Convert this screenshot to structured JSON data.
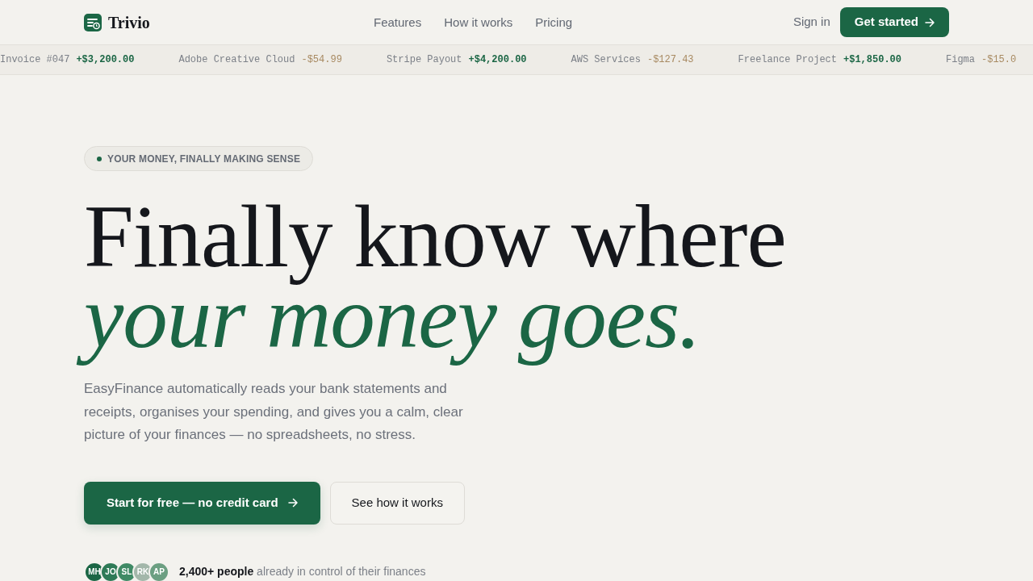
{
  "navbar": {
    "brand": "Trivio",
    "links": [
      "Features",
      "How it works",
      "Pricing"
    ],
    "sign_in": "Sign in",
    "cta": "Get started"
  },
  "ticker": [
    {
      "label": "Invoice #047",
      "amount": "+$3,200.00",
      "kind": "credit"
    },
    {
      "label": "Adobe Creative Cloud",
      "amount": "-$54.99",
      "kind": "debit"
    },
    {
      "label": "Stripe Payout",
      "amount": "+$4,200.00",
      "kind": "credit"
    },
    {
      "label": "AWS Services",
      "amount": "-$127.43",
      "kind": "debit"
    },
    {
      "label": "Freelance Project",
      "amount": "+$1,850.00",
      "kind": "credit"
    },
    {
      "label": "Figma",
      "amount": "-$15.0",
      "kind": "debit"
    }
  ],
  "hero": {
    "eyebrow": "YOUR MONEY, FINALLY MAKING SENSE",
    "headline": "Finally know where *your money goes.*",
    "description": "EasyFinance automatically reads your bank statements and receipts, organises your spending, and gives you a calm, clear picture of your finances — no spreadsheets, no stress.",
    "primary_button": "Start for free — no credit card",
    "secondary_button": "See how it works"
  },
  "social_proof": {
    "avatars": [
      {
        "initials": "MH",
        "color": "#1b6645"
      },
      {
        "initials": "JO",
        "color": "#2e7a57"
      },
      {
        "initials": "SL",
        "color": "#3f8a65"
      },
      {
        "initials": "RK",
        "color": "#a3b7aa"
      },
      {
        "initials": "AP",
        "color": "#6c9f82"
      }
    ],
    "text": "**2,400+ people** already in control of their finances"
  }
}
